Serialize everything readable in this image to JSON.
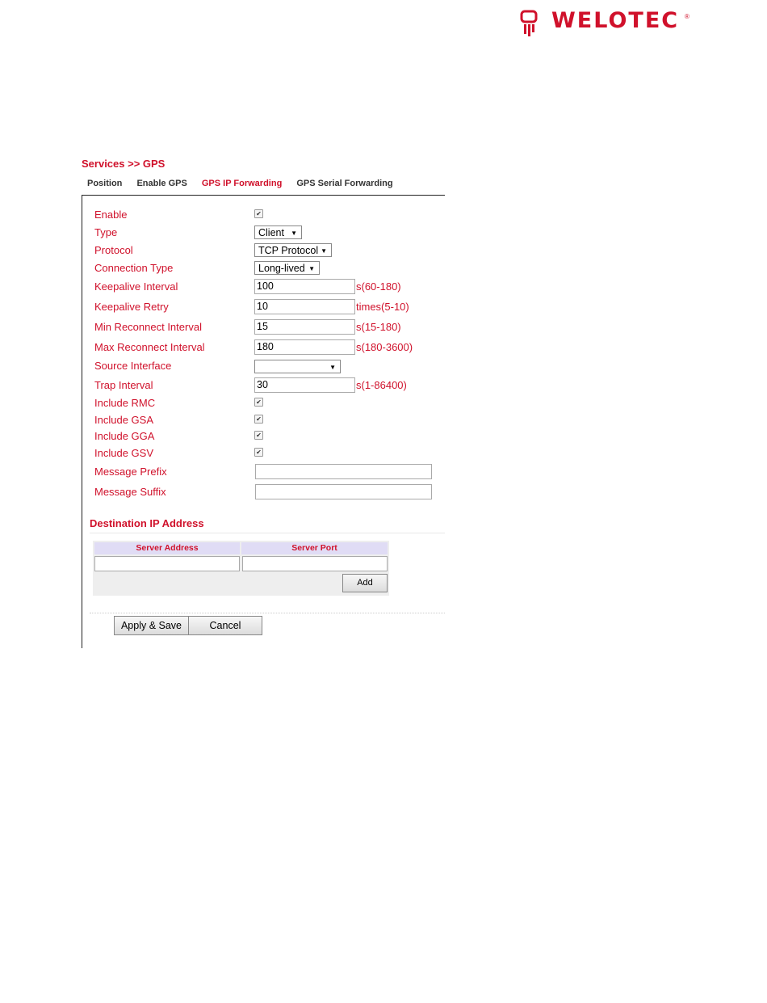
{
  "brand": {
    "logo_text": "WELOTEC",
    "color": "#d0112b"
  },
  "breadcrumb": "Services >> GPS",
  "tabs": [
    {
      "label": "Position",
      "active": false
    },
    {
      "label": "Enable GPS",
      "active": false
    },
    {
      "label": "GPS IP Forwarding",
      "active": true
    },
    {
      "label": "GPS Serial Forwarding",
      "active": false
    }
  ],
  "form": {
    "enable": {
      "label": "Enable",
      "checked": true
    },
    "type": {
      "label": "Type",
      "value": "Client"
    },
    "protocol": {
      "label": "Protocol",
      "value": "TCP Protocol"
    },
    "connection_type": {
      "label": "Connection Type",
      "value": "Long-lived"
    },
    "keepalive_interval": {
      "label": "Keepalive Interval",
      "value": "100",
      "hint": "s(60-180)"
    },
    "keepalive_retry": {
      "label": "Keepalive Retry",
      "value": "10",
      "hint": "times(5-10)"
    },
    "min_reconnect": {
      "label": "Min Reconnect Interval",
      "value": "15",
      "hint": "s(15-180)"
    },
    "max_reconnect": {
      "label": "Max Reconnect Interval",
      "value": "180",
      "hint": "s(180-3600)"
    },
    "source_interface": {
      "label": "Source Interface",
      "value": ""
    },
    "trap_interval": {
      "label": "Trap Interval",
      "value": "30",
      "hint": "s(1-86400)"
    },
    "include_rmc": {
      "label": "Include RMC",
      "checked": true
    },
    "include_gsa": {
      "label": "Include GSA",
      "checked": true
    },
    "include_gga": {
      "label": "Include GGA",
      "checked": true
    },
    "include_gsv": {
      "label": "Include GSV",
      "checked": true
    },
    "message_prefix": {
      "label": "Message Prefix",
      "value": ""
    },
    "message_suffix": {
      "label": "Message Suffix",
      "value": ""
    }
  },
  "destination": {
    "title": "Destination IP Address",
    "columns": [
      "Server Address",
      "Server Port"
    ],
    "server_address": "",
    "server_port": "",
    "add_label": "Add"
  },
  "actions": {
    "apply_label": "Apply & Save",
    "cancel_label": "Cancel"
  },
  "icons": {
    "check": "✔",
    "dropdown": "▼"
  }
}
